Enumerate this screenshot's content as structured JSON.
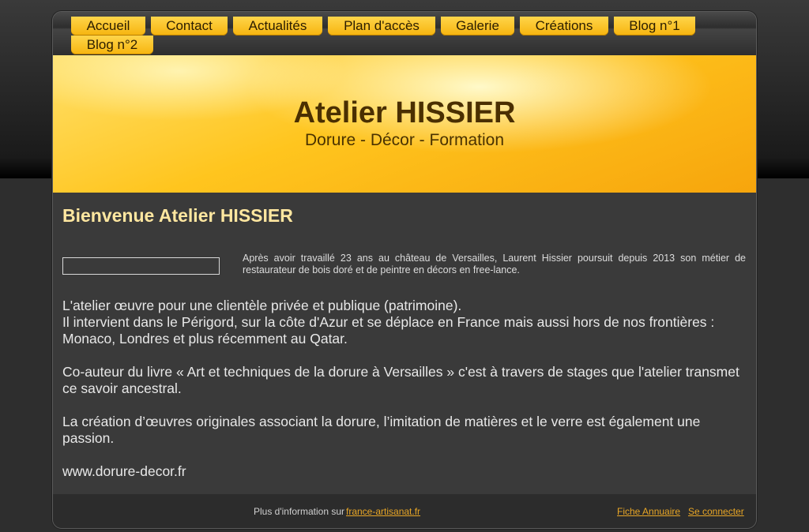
{
  "nav": {
    "row1": [
      {
        "label": "Accueil"
      },
      {
        "label": "Contact"
      },
      {
        "label": "Actualités"
      },
      {
        "label": "Plan d'accès"
      },
      {
        "label": "Galerie"
      },
      {
        "label": "Créations"
      },
      {
        "label": "Blog n°1"
      }
    ],
    "row2": [
      {
        "label": "Blog n°2"
      }
    ]
  },
  "header": {
    "title": "Atelier HISSIER",
    "subtitle": "Dorure - Décor - Formation"
  },
  "main": {
    "title": "Bienvenue Atelier HISSIER",
    "intro": "Après avoir travaillé 23 ans au château de Versailles, Laurent Hissier poursuit depuis 2013 son métier de restaurateur de bois doré et de peintre en décors en free-lance.",
    "paragraphs": [
      "L'atelier œuvre pour une clientèle privée et publique (patrimoine).",
      "Il intervient dans le Périgord, sur la côte d'Azur et se déplace en France mais aussi hors de nos frontières : Monaco, Londres et plus récemment au Qatar.",
      "",
      "Co-auteur du livre « Art et techniques de la dorure à Versailles » c'est à travers de stages que l'atelier transmet ce savoir ancestral.",
      "",
      "La création d’œuvres originales associant la dorure, l’imitation de matières et le verre est également une passion.",
      "",
      "www.dorure-decor.fr"
    ]
  },
  "footer": {
    "info_label": "Plus d'information sur",
    "info_link": "france-artisanat.fr",
    "annuaire_link": "Fiche Annuaire",
    "login_link": "Se connecter"
  },
  "colors": {
    "accent": "#f6b40e",
    "title_text": "#ffe7a0",
    "link": "#e8a626"
  }
}
